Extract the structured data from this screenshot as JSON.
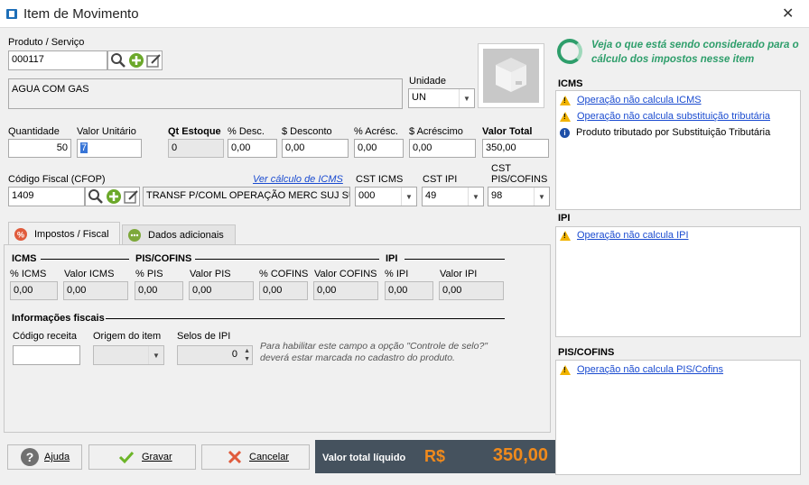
{
  "window": {
    "title": "Item de Movimento",
    "close": "✕"
  },
  "product": {
    "label": "Produto / Serviço",
    "code": "000117",
    "description": "AGUA COM GAS"
  },
  "unit": {
    "label": "Unidade",
    "value": "UN"
  },
  "info_box": {
    "text1": "Veja o que está sendo considerado para o",
    "text2": "cálculo dos impostos nesse item"
  },
  "fields": {
    "quantidade": {
      "label": "Quantidade",
      "value": "50"
    },
    "valor_unitario": {
      "label": "Valor Unitário",
      "value": "7"
    },
    "qt_estoque": {
      "label": "Qt Estoque",
      "value": "0"
    },
    "desc_pct": {
      "label": "% Desc.",
      "value": "0,00"
    },
    "desconto": {
      "label": "$ Desconto",
      "value": "0,00"
    },
    "acresc_pct": {
      "label": "% Acrésc.",
      "value": "0,00"
    },
    "acrescimo": {
      "label": "$ Acréscimo",
      "value": "0,00"
    },
    "valor_total": {
      "label": "Valor Total",
      "value": "350,00"
    }
  },
  "cfop": {
    "label": "Código Fiscal (CFOP)",
    "value": "1409",
    "link": "Ver cálculo de ICMS",
    "description": "TRANSF P/COML OPERAÇÃO MERC SUJ SUB TRIB"
  },
  "cst": {
    "icms": {
      "label": "CST ICMS",
      "value": "000"
    },
    "ipi": {
      "label": "CST IPI",
      "value": "49"
    },
    "pis_cofins": {
      "label1": "CST",
      "label2": "PIS/COFINS",
      "value": "98"
    }
  },
  "tabs": [
    {
      "label": "Impostos / Fiscal",
      "active": true
    },
    {
      "label": "Dados adicionais",
      "active": false
    }
  ],
  "taxes": {
    "icms_head": "ICMS",
    "pis_head": "PIS/COFINS",
    "ipi_head": "IPI",
    "cols": [
      {
        "label": "% ICMS",
        "value": "0,00"
      },
      {
        "label": "Valor ICMS",
        "value": "0,00"
      },
      {
        "label": "% PIS",
        "value": "0,00"
      },
      {
        "label": "Valor PIS",
        "value": "0,00"
      },
      {
        "label": "% COFINS",
        "value": "0,00"
      },
      {
        "label": "Valor COFINS",
        "value": "0,00"
      },
      {
        "label": "% IPI",
        "value": "0,00"
      },
      {
        "label": "Valor IPI",
        "value": "0,00"
      }
    ]
  },
  "fiscal_info": {
    "head": "Informações fiscais",
    "codigo_receita": "Código receita",
    "origem": "Origem do item",
    "selos": "Selos de IPI",
    "selos_value": "0",
    "hint1": "Para habilitar este campo a opção \"Controle de selo?\"",
    "hint2": "deverá estar marcada no cadastro do produto."
  },
  "right": {
    "icms": {
      "title": "ICMS",
      "items": [
        {
          "icon": "warning-icon",
          "text": "Operação não calcula ICMS",
          "link": true
        },
        {
          "icon": "warning-icon",
          "text": "Operação não calcula substituição tributária",
          "link": true
        },
        {
          "icon": "info-icon",
          "text": "Produto tributado por Substituição Tributária",
          "link": false
        }
      ]
    },
    "ipi": {
      "title": "IPI",
      "items": [
        {
          "icon": "warning-icon",
          "text": "Operação não calcula IPI",
          "link": true
        }
      ]
    },
    "pis": {
      "title": "PIS/COFINS",
      "items": [
        {
          "icon": "warning-icon",
          "text": "Operação não calcula PIS/Cofins",
          "link": true
        }
      ]
    }
  },
  "buttons": {
    "help": "Ajuda",
    "save": "Gravar",
    "cancel": "Cancelar"
  },
  "total": {
    "label": "Valor total líquido",
    "currency": "R$",
    "value": "350,00"
  },
  "colors": {
    "accent_green": "#2e9e6b",
    "total_bg": "#45525e",
    "total_value": "#f08a1c",
    "link": "#1a4bd0"
  }
}
